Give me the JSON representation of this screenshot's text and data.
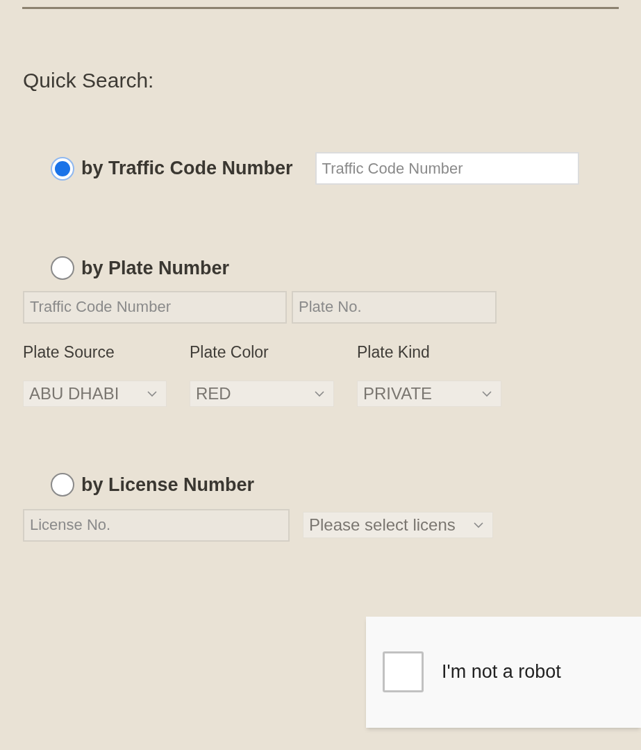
{
  "title": "Quick Search:",
  "options": [
    {
      "kind": "inline",
      "label": "by Traffic Code Number",
      "selected": true,
      "fields": [
        {
          "placeholder": "Traffic Code Number",
          "disabled": false
        }
      ]
    },
    {
      "kind": "plate",
      "label": "by Plate Number",
      "selected": false,
      "fields": [
        {
          "placeholder": "Traffic Code Number",
          "disabled": true
        },
        {
          "placeholder": "Plate No.",
          "disabled": true
        }
      ],
      "selects": [
        {
          "label": "Plate Source",
          "value": "ABU DHABI"
        },
        {
          "label": "Plate Color",
          "value": "RED"
        },
        {
          "label": "Plate Kind",
          "value": "PRIVATE"
        }
      ]
    },
    {
      "kind": "license",
      "label": "by License Number",
      "selected": false,
      "fields": [
        {
          "placeholder": "License No.",
          "disabled": true
        }
      ],
      "selects": [
        {
          "value": "Please select licens"
        }
      ]
    }
  ],
  "captcha": {
    "label": "I'm not a robot",
    "checked": false
  }
}
